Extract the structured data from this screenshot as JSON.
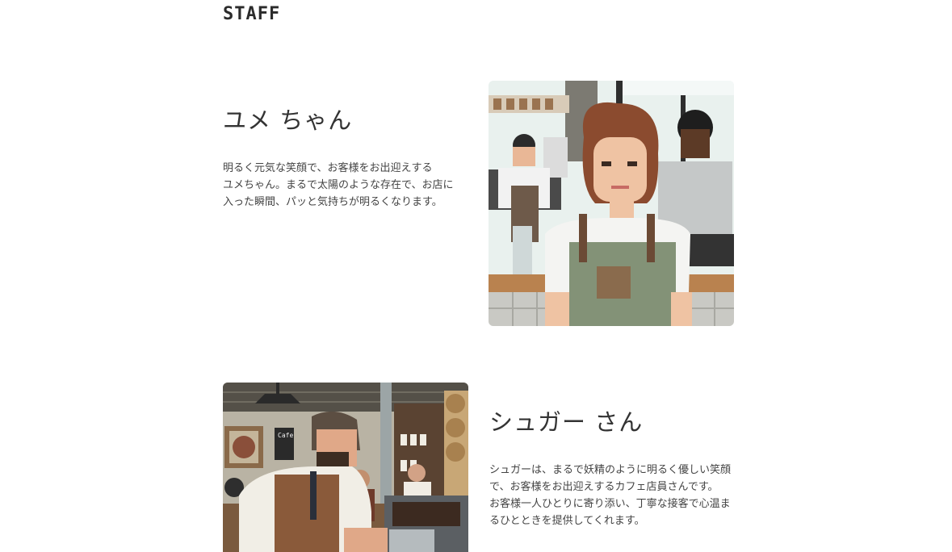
{
  "page": {
    "section_title": "STAFF"
  },
  "staff": [
    {
      "name": "ユメ ちゃん",
      "description_lines": [
        "明るく元気な笑顔で、お客様をお出迎えする",
        "ユメちゃん。まるで太陽のような存在で、お店に",
        "入った瞬間、パッと気持ちが明るくなります。"
      ],
      "photo_icon": "pixel-art-barista-woman-icon"
    },
    {
      "name": "シュガー さん",
      "description_lines": [
        "シュガーは、まるで妖精のように明るく優しい笑顔",
        "で、お客様をお出迎えするカフェ店員さんです。",
        "お客様一人ひとりに寄り添い、丁寧な接客で心温ま",
        "るひとときを提供してくれます。"
      ],
      "photo_icon": "pixel-art-barista-man-icon",
      "photo_sign_text": "Cafe"
    }
  ],
  "colors": {
    "text": "#333333",
    "background": "#ffffff"
  }
}
